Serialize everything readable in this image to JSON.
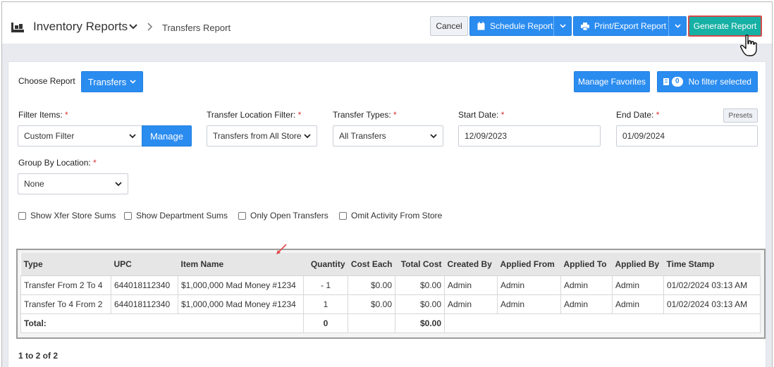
{
  "header": {
    "app_title": "Inventory Reports",
    "breadcrumb": "Transfers Report",
    "cancel": "Cancel",
    "schedule": "Schedule Report",
    "print_export": "Print/Export Report",
    "generate": "Generate Report"
  },
  "report": {
    "choose_label": "Choose Report",
    "selected": "Transfers",
    "manage_favorites": "Manage Favorites",
    "filter_count": "0",
    "filter_status": "No filter selected"
  },
  "filters": {
    "filter_items": {
      "label": "Filter Items:",
      "value": "Custom Filter",
      "manage": "Manage"
    },
    "location_filter": {
      "label": "Transfer Location Filter:",
      "value": "Transfers from All Store"
    },
    "transfer_types": {
      "label": "Transfer Types:",
      "value": "All Transfers"
    },
    "start_date": {
      "label": "Start Date:",
      "value": "12/09/2023"
    },
    "end_date": {
      "label": "End Date:",
      "value": "01/09/2024",
      "presets": "Presets"
    },
    "group_by": {
      "label": "Group By Location:",
      "value": "None"
    },
    "required_mark": "*"
  },
  "options": [
    "Show Xfer Store Sums",
    "Show Department Sums",
    "Only Open Transfers",
    "Omit Activity From Store"
  ],
  "table": {
    "columns": [
      "Type",
      "UPC",
      "Item Name",
      "Quantity",
      "Cost Each",
      "Total Cost",
      "Created By",
      "Applied From",
      "Applied To",
      "Applied By",
      "Time Stamp"
    ],
    "rows": [
      [
        "Transfer From 2 To 4",
        "644018112340",
        "$1,000,000 Mad Money #1234",
        "- 1",
        "$0.00",
        "$0.00",
        "Admin",
        "Admin",
        "Admin",
        "Admin",
        "01/02/2024 03:13 AM"
      ],
      [
        "Transfer To 4 From 2",
        "644018112340",
        "$1,000,000 Mad Money #1234",
        "1",
        "$0.00",
        "$0.00",
        "Admin",
        "Admin",
        "Admin",
        "Admin",
        "01/02/2024 03:13 AM"
      ]
    ],
    "total": {
      "label": "Total:",
      "quantity": "0",
      "total_cost": "$0.00"
    }
  },
  "pager": "1 to 2 of 2",
  "colors": {
    "primary": "#2b8cf0",
    "generate": "#16b0a4",
    "highlight": "#d64a4a",
    "required": "#d9302f"
  }
}
